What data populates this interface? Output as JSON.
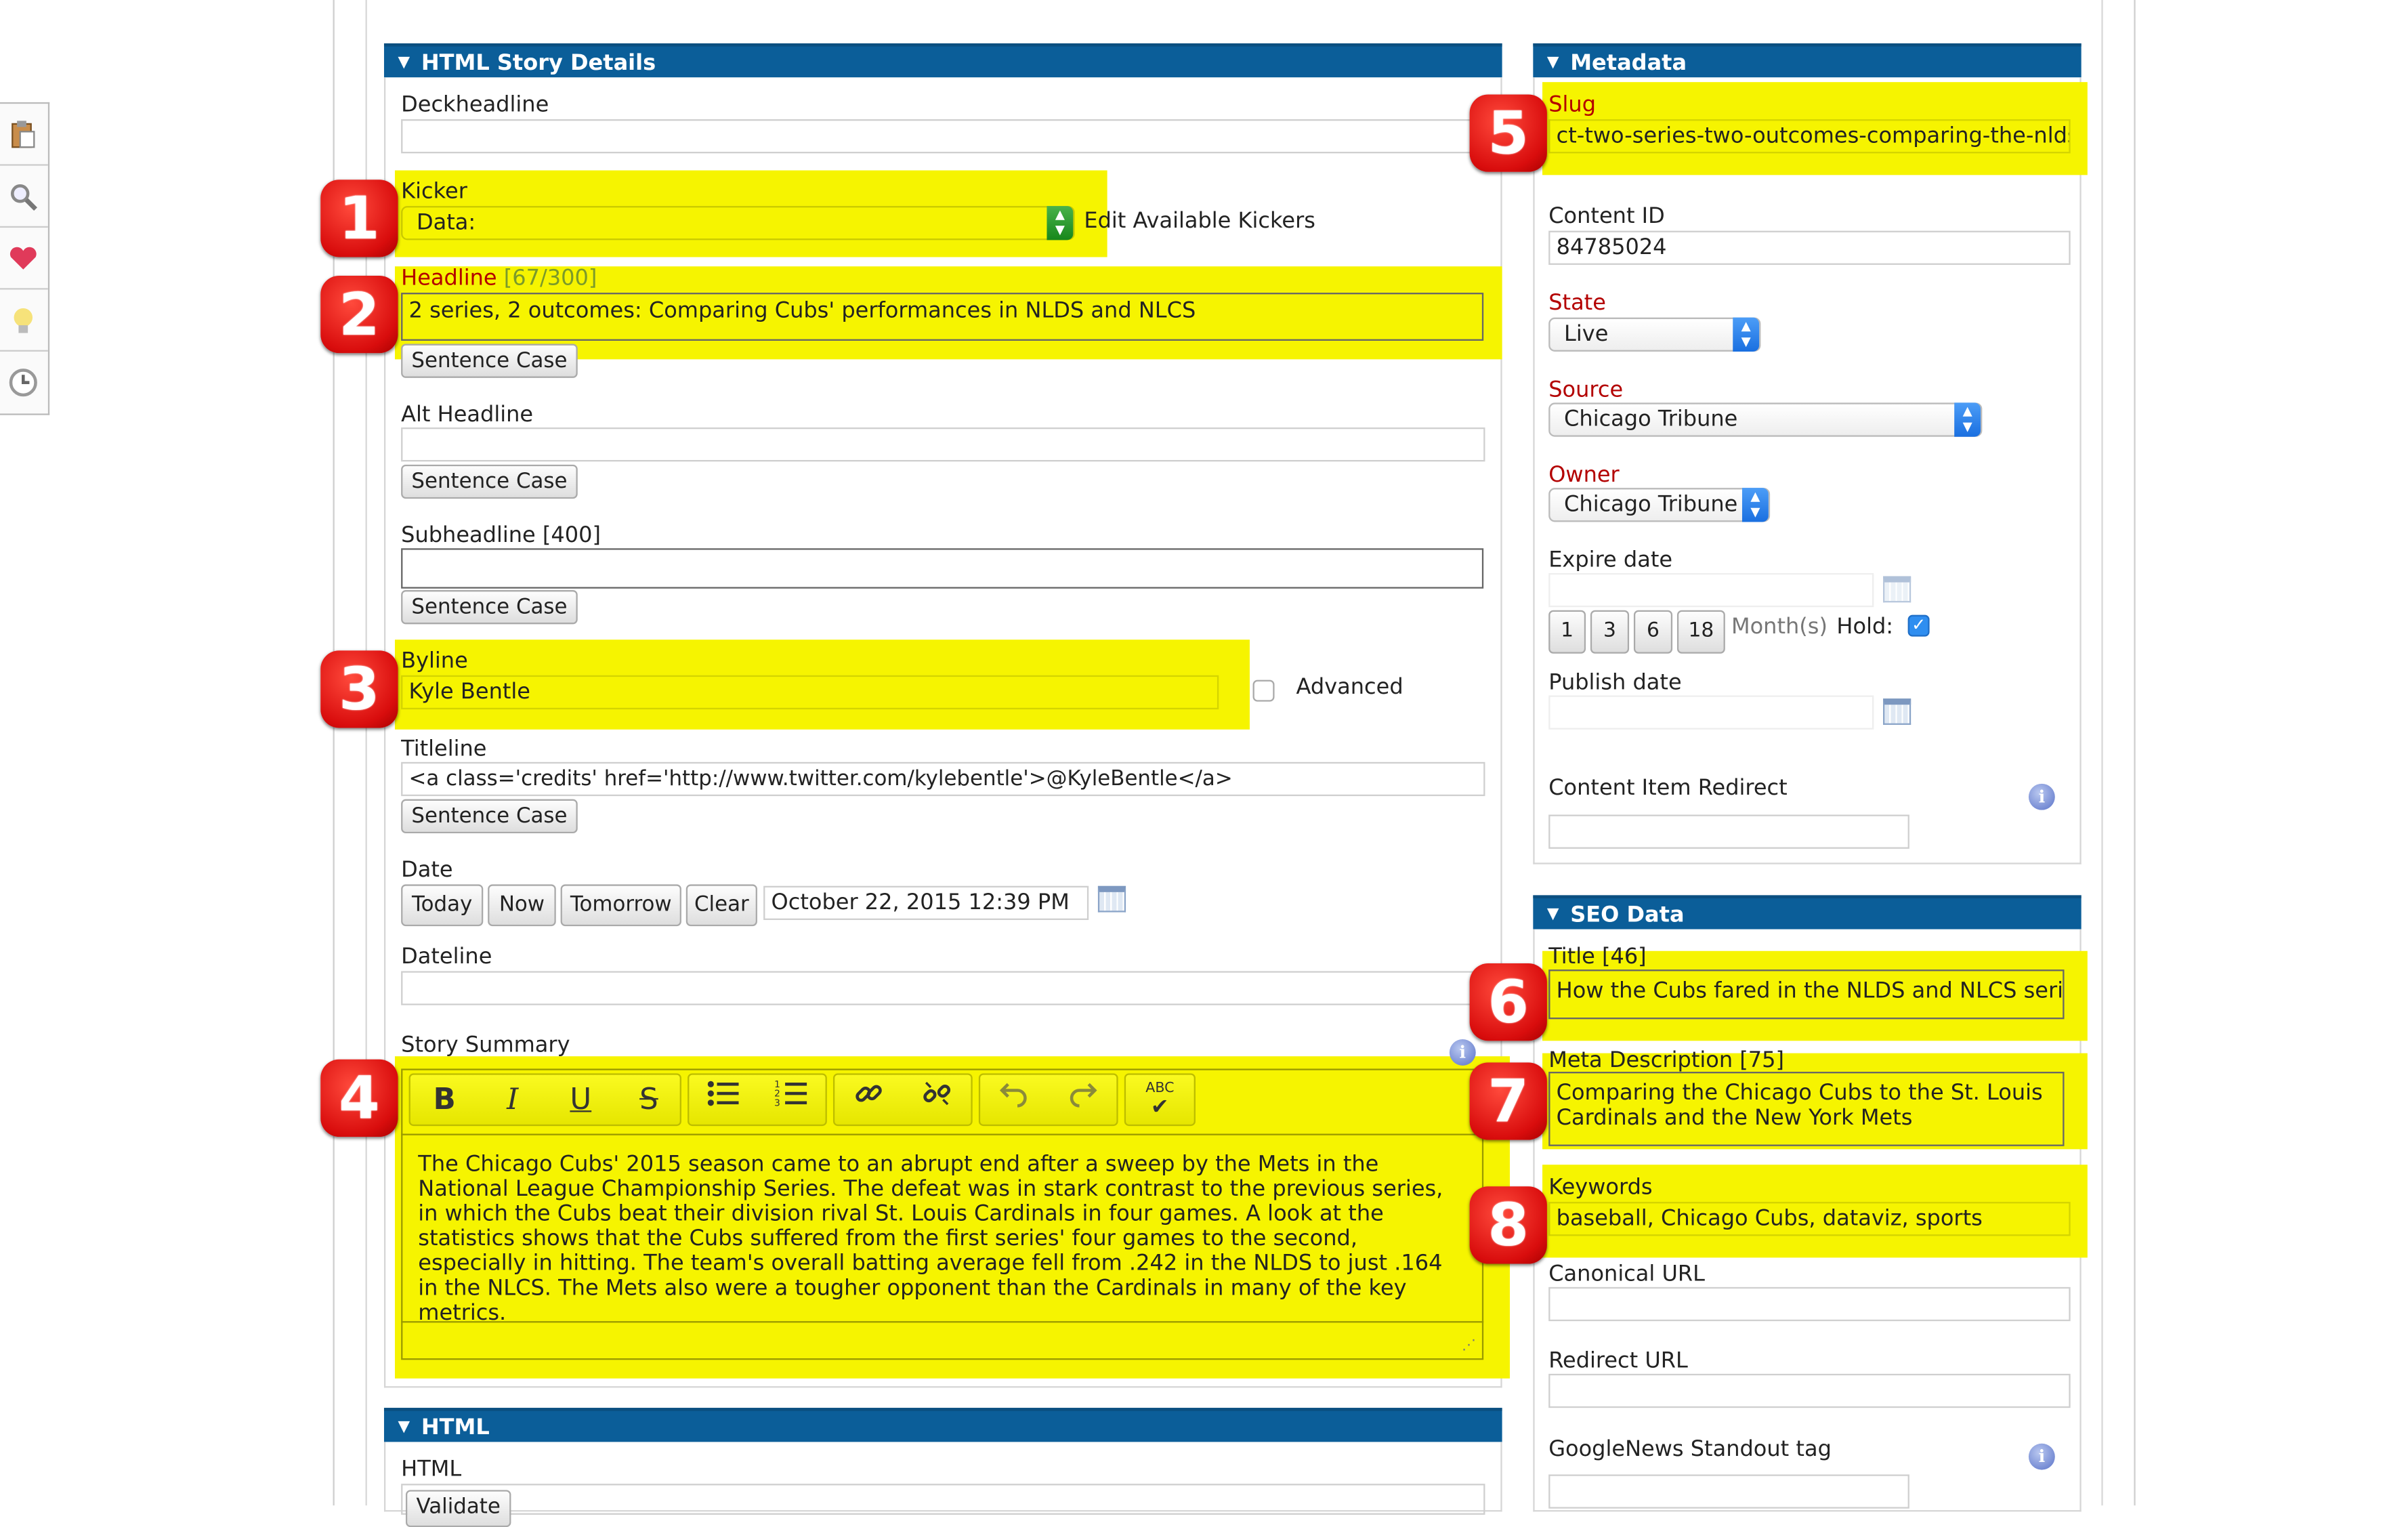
{
  "colors": {
    "panel_header": "#0b5e99",
    "highlight": "#f6f400",
    "badge": "#d90d0d",
    "required_label": "#b30000"
  },
  "left_rail": {
    "icons": [
      "clipboard-icon",
      "search-icon",
      "heart-icon",
      "lightbulb-icon",
      "clock-icon"
    ]
  },
  "badges": [
    "1",
    "2",
    "3",
    "4",
    "5",
    "6",
    "7",
    "8"
  ],
  "story": {
    "title": "HTML Story Details",
    "deckheadline_label": "Deckheadline",
    "deckheadline_value": "",
    "kicker_label": "Kicker",
    "kicker_value": "Data:",
    "edit_kickers": "Edit Available Kickers",
    "headline_label": "Headline",
    "headline_count": "[67/300]",
    "headline_value": "2 series, 2 outcomes: Comparing Cubs' performances in NLDS and NLCS",
    "sentence_case": "Sentence Case",
    "alt_headline_label": "Alt Headline",
    "subheadline_label": "Subheadline [400]",
    "byline_label": "Byline",
    "byline_value": "Kyle Bentle",
    "advanced_label": "Advanced",
    "titleline_label": "Titleline",
    "titleline_value": "<a class='credits' href='http://www.twitter.com/kylebentle'>@KyleBentle</a>",
    "date_label": "Date",
    "date_buttons": [
      "Today",
      "Now",
      "Tomorrow",
      "Clear"
    ],
    "date_value": "October 22, 2015 12:39 PM",
    "dateline_label": "Dateline",
    "summary_label": "Story Summary",
    "summary_text": "The Chicago Cubs' 2015 season came to an abrupt end after a sweep by the Mets in the National League Championship Series. The defeat was in stark contrast to the previous series, in which the Cubs beat their division rival St. Louis Cardinals in four games. A look at the statistics shows that the Cubs suffered from the first series' four games to the second, especially in hitting. The team's overall batting average fell from .242 in the NLDS to just .164 in the NLCS. The Mets also were a tougher opponent than the Cardinals in many of the key metrics.",
    "toolbar": {
      "bold": "B",
      "italic": "I",
      "underline": "U",
      "strike": "S",
      "bullets": "bullets-icon",
      "numbers": "numbered-list-icon",
      "link": "link-icon",
      "unlink": "unlink-icon",
      "undo": "undo-icon",
      "redo": "redo-icon",
      "spell": "ABC"
    }
  },
  "html_panel": {
    "title": "HTML",
    "label": "HTML",
    "validate": "Validate"
  },
  "metadata": {
    "title": "Metadata",
    "slug_label": "Slug",
    "slug_value": "ct-two-series-two-outcomes-comparing-the-nlds-a",
    "content_id_label": "Content ID",
    "content_id_value": "84785024",
    "state_label": "State",
    "state_value": "Live",
    "source_label": "Source",
    "source_value": "Chicago Tribune",
    "owner_label": "Owner",
    "owner_value": "Chicago Tribune",
    "expire_label": "Expire date",
    "months": [
      "1",
      "3",
      "6",
      "18"
    ],
    "months_label": "Month(s)",
    "hold_label": "Hold:",
    "hold_checked": true,
    "publish_label": "Publish date",
    "redirect_label": "Content Item Redirect"
  },
  "seo": {
    "title": "SEO Data",
    "title_label": "Title [46]",
    "title_value": "How the Cubs fared in the NLDS and NLCS series",
    "meta_label": "Meta Description [75]",
    "meta_value": "Comparing the Chicago Cubs to the St. Louis Cardinals and the New York Mets",
    "keywords_label": "Keywords",
    "keywords_value": "baseball, Chicago Cubs, dataviz, sports",
    "canonical_label": "Canonical URL",
    "redirect_label": "Redirect URL",
    "googlenews_label": "GoogleNews Standout tag"
  }
}
